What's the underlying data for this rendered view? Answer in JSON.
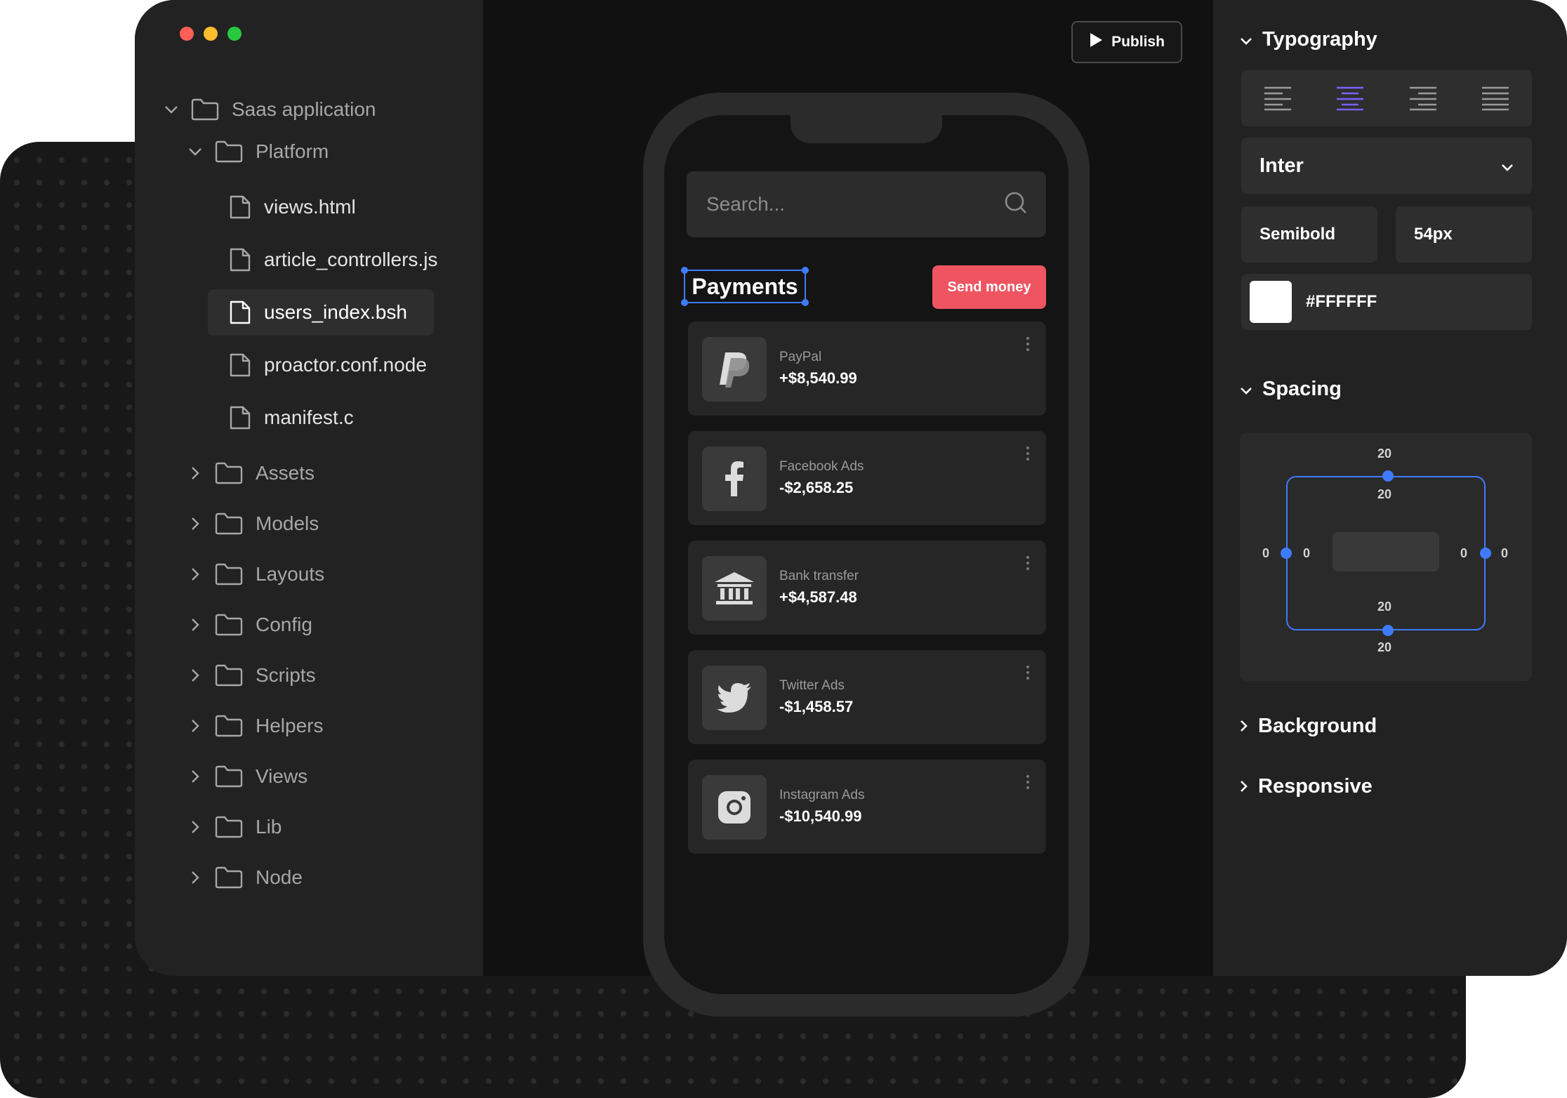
{
  "window": {
    "traffic_lights": [
      "#fe5f57",
      "#febc2e",
      "#28c840"
    ]
  },
  "sidebar": {
    "root": {
      "label": "Saas application",
      "icon": "folder-icon",
      "expanded": true
    },
    "platform": {
      "label": "Platform",
      "icon": "folder-icon",
      "expanded": true
    },
    "files": [
      {
        "label": "views.html",
        "icon": "file-icon"
      },
      {
        "label": "article_controllers.js",
        "icon": "file-icon"
      },
      {
        "label": "users_index.bsh",
        "icon": "file-icon",
        "selected": true
      },
      {
        "label": "proactor.conf.node",
        "icon": "file-icon"
      },
      {
        "label": "manifest.c",
        "icon": "file-icon"
      }
    ],
    "folders": [
      {
        "label": "Assets",
        "icon": "folder-icon"
      },
      {
        "label": "Models",
        "icon": "folder-icon"
      },
      {
        "label": "Layouts",
        "icon": "folder-icon"
      },
      {
        "label": "Config",
        "icon": "folder-icon"
      },
      {
        "label": "Scripts",
        "icon": "folder-icon"
      },
      {
        "label": "Helpers",
        "icon": "folder-icon"
      },
      {
        "label": "Views",
        "icon": "folder-icon"
      },
      {
        "label": "Lib",
        "icon": "folder-icon"
      },
      {
        "label": "Node",
        "icon": "folder-icon"
      }
    ]
  },
  "toolbar": {
    "publish_label": "Publish",
    "publish_icon": "play-icon"
  },
  "phone": {
    "search": {
      "placeholder": "Search...",
      "icon": "search-icon"
    },
    "title": "Payments",
    "send_button": "Send money",
    "send_color": "#ef5561",
    "payments": [
      {
        "name": "PayPal",
        "amount": "+$8,540.99",
        "icon": "paypal-icon"
      },
      {
        "name": "Facebook Ads",
        "amount": "-$2,658.25",
        "icon": "facebook-icon"
      },
      {
        "name": "Bank transfer",
        "amount": "+$4,587.48",
        "icon": "bank-icon"
      },
      {
        "name": "Twitter Ads",
        "amount": "-$1,458.57",
        "icon": "twitter-icon"
      },
      {
        "name": "Instagram Ads",
        "amount": "-$10,540.99",
        "icon": "instagram-icon"
      }
    ]
  },
  "properties": {
    "typography": {
      "label": "Typography",
      "alignments": [
        "left",
        "center",
        "right",
        "justify"
      ],
      "active_alignment": "center",
      "active_color": "#7b61ff",
      "font": "Inter",
      "weight": "Semibold",
      "size": "54px",
      "color_hex": "#FFFFFF",
      "color_swatch": "#ffffff"
    },
    "spacing": {
      "label": "Spacing",
      "margin_top": "20",
      "margin_bottom": "20",
      "margin_left": "0",
      "margin_right": "0",
      "padding_top": "20",
      "padding_bottom": "20",
      "padding_left": "0",
      "padding_right": "0",
      "accent": "#3f7bff"
    },
    "background": {
      "label": "Background",
      "expanded": false
    },
    "responsive": {
      "label": "Responsive",
      "expanded": false
    }
  }
}
